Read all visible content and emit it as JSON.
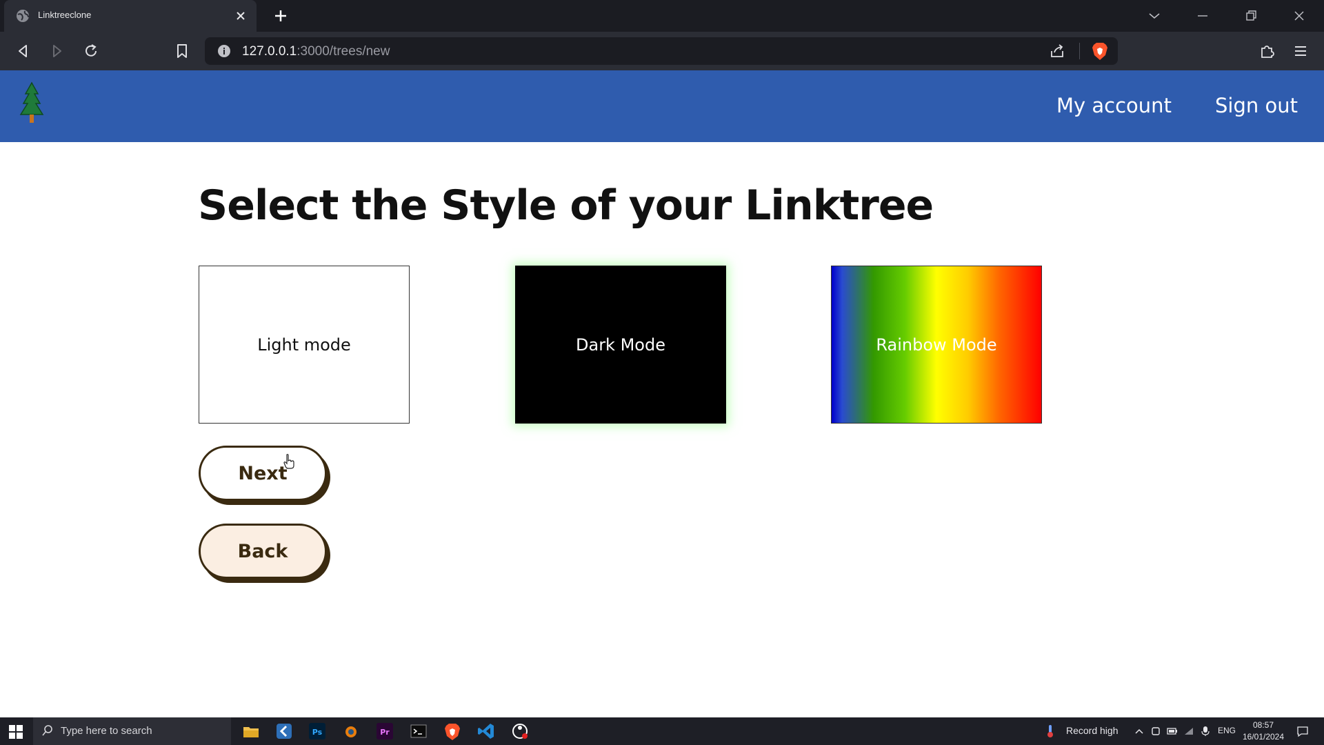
{
  "browser": {
    "tab": {
      "title": "Linktreeclone"
    },
    "url": {
      "host": "127.0.0.1",
      "path": ":3000/trees/new"
    }
  },
  "header": {
    "nav": {
      "my_account": "My account",
      "sign_out": "Sign out"
    }
  },
  "main": {
    "title": "Select the Style of your Linktree",
    "modes": [
      {
        "label": "Light mode"
      },
      {
        "label": "Dark Mode"
      },
      {
        "label": "Rainbow Mode"
      }
    ],
    "buttons": {
      "next": "Next",
      "back": "Back"
    }
  },
  "taskbar": {
    "search_placeholder": "Type here to search",
    "weather": "Record high",
    "language": "ENG",
    "time": "08:57",
    "date": "16/01/2024"
  },
  "colors": {
    "header_bg": "#2f5cae",
    "button_border": "#3a2a10",
    "back_bg": "#fbeee2"
  }
}
